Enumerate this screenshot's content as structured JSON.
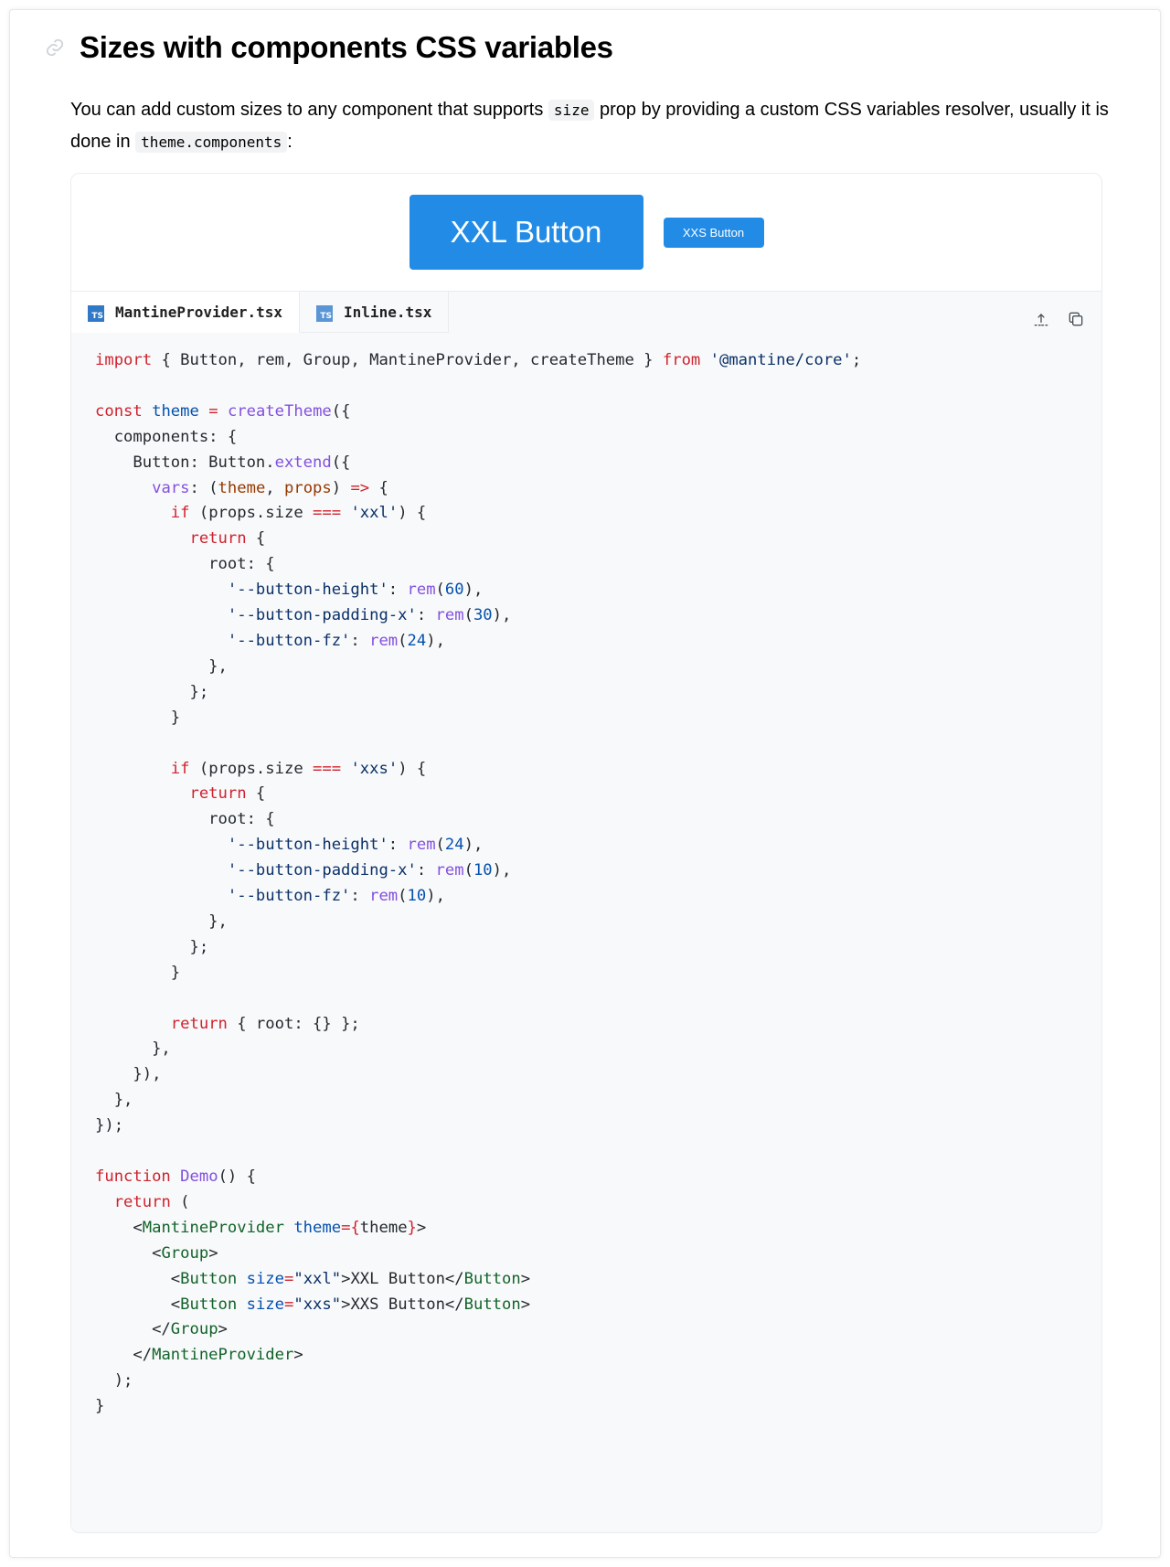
{
  "section": {
    "title": "Sizes with components CSS variables",
    "desc_before": "You can add custom sizes to any component that supports ",
    "desc_code1": "size",
    "desc_mid": " prop by providing a custom CSS variables resolver, usually it is done in ",
    "desc_code2": "theme.components",
    "desc_after": ":"
  },
  "preview": {
    "xxl_label": "XXL Button",
    "xxs_label": "XXS Button"
  },
  "tabs": [
    {
      "label": "MantineProvider.tsx",
      "icon": "ts-icon",
      "active": true
    },
    {
      "label": "Inline.tsx",
      "icon": "ts-icon",
      "active": false
    }
  ],
  "tools": {
    "expand_icon": "expand-icon",
    "copy_icon": "copy-icon"
  },
  "colors": {
    "button_blue": "#228be6",
    "ts_blue": "#3178c6"
  },
  "code_lines": [
    "import { Button, rem, Group, MantineProvider, createTheme } from '@mantine/core';",
    "",
    "const theme = createTheme({",
    "  components: {",
    "    Button: Button.extend({",
    "      vars: (theme, props) => {",
    "        if (props.size === 'xxl') {",
    "          return {",
    "            root: {",
    "              '--button-height': rem(60),",
    "              '--button-padding-x': rem(30),",
    "              '--button-fz': rem(24),",
    "            },",
    "          };",
    "        }",
    "",
    "        if (props.size === 'xxs') {",
    "          return {",
    "            root: {",
    "              '--button-height': rem(24),",
    "              '--button-padding-x': rem(10),",
    "              '--button-fz': rem(10),",
    "            },",
    "          };",
    "        }",
    "",
    "        return { root: {} };",
    "      },",
    "    }),",
    "  },",
    "});",
    "",
    "function Demo() {",
    "  return (",
    "    <MantineProvider theme={theme}>",
    "      <Group>",
    "        <Button size=\"xxl\">XXL Button</Button>",
    "        <Button size=\"xxs\">XXS Button</Button>",
    "      </Group>",
    "    </MantineProvider>",
    "  );",
    "}"
  ]
}
